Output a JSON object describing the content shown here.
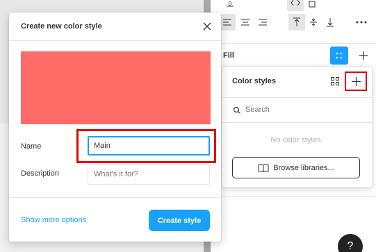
{
  "dialog": {
    "title": "Create new color style",
    "swatch_color": "#ff6b66",
    "name_label": "Name",
    "name_value": "Main",
    "description_label": "Description",
    "description_placeholder": "What's it for?",
    "show_more_label": "Show more options",
    "create_label": "Create style"
  },
  "panel": {
    "fill_label": "Fill",
    "accent_color": "#18a0fb"
  },
  "color_styles": {
    "title": "Color styles",
    "search_placeholder": "Search",
    "empty_text": "No color styles.",
    "browse_label": "Browse libraries..."
  },
  "help": {
    "label": "?"
  },
  "icons": [
    "close-icon",
    "grid-icon",
    "plus-icon",
    "search-icon",
    "book-icon",
    "align-left-icon",
    "align-center-icon",
    "align-right-icon",
    "align-top-icon",
    "align-middle-icon",
    "align-bottom-icon",
    "more-icon"
  ]
}
